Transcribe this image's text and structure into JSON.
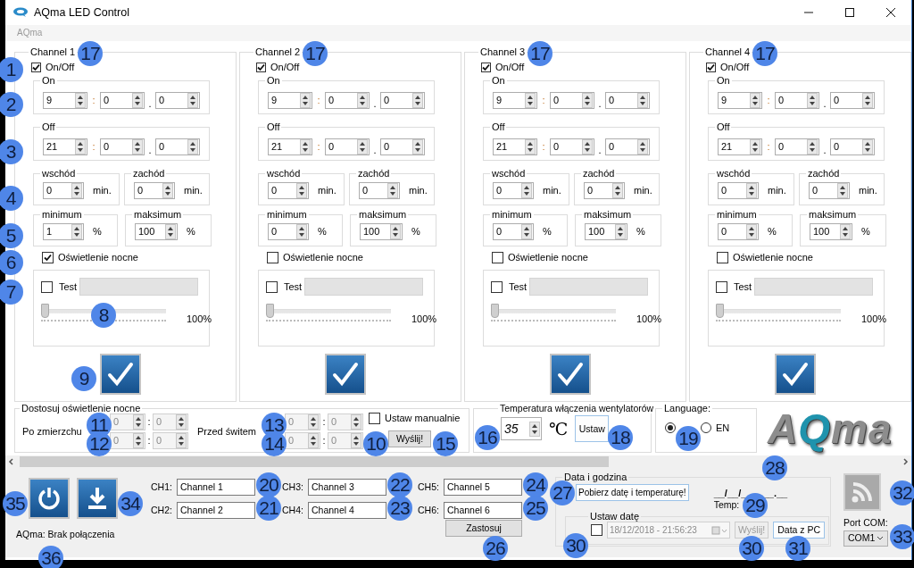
{
  "window": {
    "title": "AQma LED Control"
  },
  "menu": {
    "label": "AQma",
    "disabled": true
  },
  "channels": [
    {
      "title": "Channel 1",
      "enabled": {
        "label": "On/Off",
        "checked": true
      },
      "on": {
        "title": "On",
        "fields": [
          "9",
          "0",
          "0"
        ],
        "separators": [
          ":",
          "."
        ]
      },
      "off": {
        "title": "Off",
        "fields": [
          "21",
          "0",
          "0"
        ],
        "separators": [
          ":",
          "."
        ]
      },
      "sunrise": {
        "title": "wschód",
        "value": "0",
        "unit": "min."
      },
      "sunset": {
        "title": "zachód",
        "value": "0",
        "unit": "min."
      },
      "minimum": {
        "title": "minimum",
        "value": "1",
        "unit": "%"
      },
      "maximum": {
        "title": "maksimum",
        "value": "100",
        "unit": "%"
      },
      "night_light": {
        "label": "Oświetlenie nocne",
        "checked": true
      },
      "test": {
        "label": "Test",
        "checked": false
      },
      "slider": {
        "level": 0,
        "reading": "100%"
      }
    },
    {
      "title": "Channel 2",
      "enabled": {
        "label": "On/Off",
        "checked": true
      },
      "on": {
        "title": "On",
        "fields": [
          "9",
          "0",
          "0"
        ],
        "separators": [
          ":",
          "."
        ]
      },
      "off": {
        "title": "Off",
        "fields": [
          "21",
          "0",
          "0"
        ],
        "separators": [
          ":",
          "."
        ]
      },
      "sunrise": {
        "title": "wschód",
        "value": "0",
        "unit": "min."
      },
      "sunset": {
        "title": "zachód",
        "value": "0",
        "unit": "min."
      },
      "minimum": {
        "title": "minimum",
        "value": "0",
        "unit": "%"
      },
      "maximum": {
        "title": "maksimum",
        "value": "100",
        "unit": "%"
      },
      "night_light": {
        "label": "Oświetlenie nocne",
        "checked": false
      },
      "test": {
        "label": "Test",
        "checked": false
      },
      "slider": {
        "level": 0,
        "reading": "100%"
      }
    },
    {
      "title": "Channel 3",
      "enabled": {
        "label": "On/Off",
        "checked": true
      },
      "on": {
        "title": "On",
        "fields": [
          "9",
          "0",
          "0"
        ],
        "separators": [
          ":",
          "."
        ]
      },
      "off": {
        "title": "Off",
        "fields": [
          "21",
          "0",
          "0"
        ],
        "separators": [
          ":",
          "."
        ]
      },
      "sunrise": {
        "title": "wschód",
        "value": "0",
        "unit": "min."
      },
      "sunset": {
        "title": "zachód",
        "value": "0",
        "unit": "min."
      },
      "minimum": {
        "title": "minimum",
        "value": "0",
        "unit": "%"
      },
      "maximum": {
        "title": "maksimum",
        "value": "100",
        "unit": "%"
      },
      "night_light": {
        "label": "Oświetlenie nocne",
        "checked": false
      },
      "test": {
        "label": "Test",
        "checked": false
      },
      "slider": {
        "level": 0,
        "reading": "100%"
      }
    },
    {
      "title": "Channel 4",
      "enabled": {
        "label": "On/Off",
        "checked": true
      },
      "on": {
        "title": "On",
        "fields": [
          "9",
          "0",
          "0"
        ],
        "separators": [
          ":",
          "."
        ]
      },
      "off": {
        "title": "Off",
        "fields": [
          "21",
          "0",
          "0"
        ],
        "separators": [
          ":",
          "."
        ]
      },
      "sunrise": {
        "title": "wschód",
        "value": "0",
        "unit": "min."
      },
      "sunset": {
        "title": "zachód",
        "value": "0",
        "unit": "min."
      },
      "minimum": {
        "title": "minimum",
        "value": "0",
        "unit": "%"
      },
      "maximum": {
        "title": "maksimum",
        "value": "100",
        "unit": "%"
      },
      "night_light": {
        "label": "Oświetlenie nocne",
        "checked": false
      },
      "test": {
        "label": "Test",
        "checked": false
      },
      "slider": {
        "level": 0,
        "reading": "100%"
      }
    }
  ],
  "night": {
    "title": "Dostosuj oświetlenie nocne",
    "disabled": true,
    "groups": [
      {
        "label": "Po zmierzchu",
        "rows": [
          {
            "fields": [
              "0",
              "0"
            ],
            "separator": ":"
          },
          {
            "fields": [
              "0",
              "0"
            ],
            "separator": ":"
          }
        ]
      },
      {
        "label": "Przed świtem",
        "rows": [
          {
            "fields": [
              "0",
              "0"
            ],
            "separator": ":"
          },
          {
            "fields": [
              "0",
              "0"
            ],
            "separator": ":"
          }
        ]
      }
    ],
    "manual": {
      "label": "Ustaw manualnie",
      "checked": false
    },
    "send_button": "Wyślij!"
  },
  "temperature": {
    "title": "Temperatura włączenia wentylatorów",
    "value": "35",
    "unit": "℃",
    "button": "Ustaw"
  },
  "language": {
    "title": "Language:",
    "options": [
      {
        "selected": true
      },
      {
        "label": "EN",
        "selected": false
      }
    ]
  },
  "logo": {
    "text": "AQma"
  },
  "channel_names": {
    "fields": [
      {
        "label": "CH1:",
        "value": "Channel 1"
      },
      {
        "label": "CH2:",
        "value": "Channel 2"
      },
      {
        "label": "CH3:",
        "value": "Channel 3"
      },
      {
        "label": "CH4:",
        "value": "Channel 4"
      },
      {
        "label": "CH5:",
        "value": "Channel 5"
      },
      {
        "label": "CH6:",
        "value": "Channel 6"
      }
    ],
    "apply_button": "Zastosuj"
  },
  "datetime": {
    "title": "Data i godzina",
    "fetch_button": "Pobierz datę i temperaturę!",
    "reading": "__/__/______.__",
    "temp_label": "Temp:",
    "set_date": {
      "title": "Ustaw datę",
      "checked": false,
      "value": "18/12/2018 - 21:56:23",
      "disabled": true,
      "send_button": "Wyślij!",
      "send_disabled": true,
      "pc_button": "Data z PC"
    }
  },
  "port": {
    "label": "Port COM:",
    "value": "COM1"
  },
  "status": "AQma: Brak połączenia",
  "markers": [
    {
      "label": "17"
    },
    {
      "label": "17"
    },
    {
      "label": "17"
    },
    {
      "label": "17"
    },
    {
      "label": "1"
    },
    {
      "label": "2"
    },
    {
      "label": "3"
    },
    {
      "label": "4"
    },
    {
      "label": "5"
    },
    {
      "label": "6"
    },
    {
      "label": "7"
    },
    {
      "label": "8"
    },
    {
      "label": "9"
    },
    {
      "label": "11"
    },
    {
      "label": "13"
    },
    {
      "label": "12"
    },
    {
      "label": "14"
    },
    {
      "label": "10"
    },
    {
      "label": "15"
    },
    {
      "label": "16"
    },
    {
      "label": "18"
    },
    {
      "label": "19"
    },
    {
      "label": "20"
    },
    {
      "label": "22"
    },
    {
      "label": "24"
    },
    {
      "label": "21"
    },
    {
      "label": "23"
    },
    {
      "label": "25"
    },
    {
      "label": "28"
    },
    {
      "label": "27"
    },
    {
      "label": "29"
    },
    {
      "label": "32"
    },
    {
      "label": "35"
    },
    {
      "label": "34"
    },
    {
      "label": "33"
    },
    {
      "label": "26"
    },
    {
      "label": "30"
    },
    {
      "label": "30"
    },
    {
      "label": "31"
    },
    {
      "label": "36"
    }
  ]
}
